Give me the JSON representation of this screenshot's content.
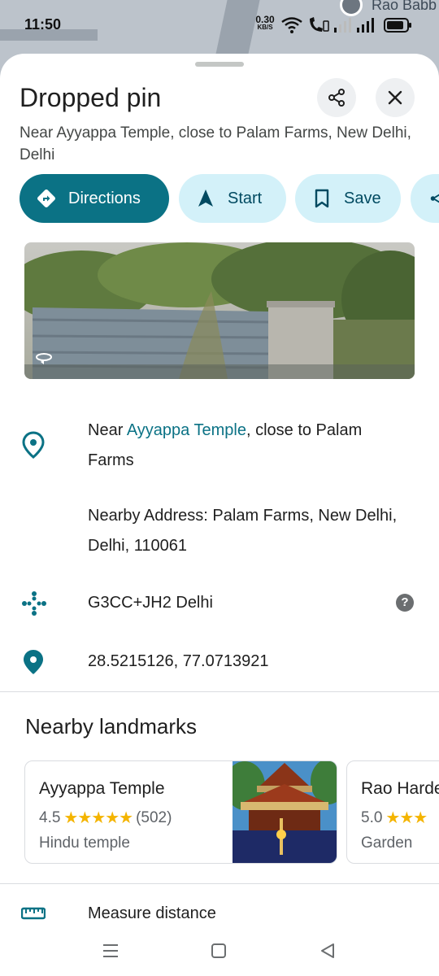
{
  "status_bar": {
    "time": "11:50",
    "net_speed": "0.30",
    "net_unit": "KB/S"
  },
  "map": {
    "label": "Rao Babb"
  },
  "place": {
    "title": "Dropped pin",
    "subtitle": "Near Ayyappa Temple, close to Palam Farms, New Delhi, Delhi"
  },
  "actions": [
    {
      "label": "Directions",
      "icon": "directions-icon"
    },
    {
      "label": "Start",
      "icon": "navigation-arrow-icon"
    },
    {
      "label": "Save",
      "icon": "bookmark-icon"
    },
    {
      "label": "",
      "icon": "share-icon"
    }
  ],
  "info": {
    "near_prefix": "Near ",
    "near_link": "Ayyappa Temple",
    "near_suffix": ", close to Palam",
    "near_line2": "Farms",
    "nearby_line1": "Nearby Address: Palam Farms, New Delhi,",
    "nearby_line2": "Delhi, 110061",
    "plus_code": "G3CC+JH2 Delhi",
    "help_glyph": "?",
    "coordinates": "28.5215126, 77.0713921"
  },
  "nearby": {
    "title": "Nearby landmarks",
    "cards": [
      {
        "name": "Ayyappa Temple",
        "rating": "4.5",
        "stars": "★★★★★",
        "reviews": "(502)",
        "type": "Hindu temple"
      },
      {
        "name": "Rao Harde",
        "rating": "5.0",
        "stars": "★★★",
        "reviews": "",
        "type": "Garden"
      }
    ]
  },
  "measure": {
    "label": "Measure distance"
  },
  "colors": {
    "accent": "#0b7285",
    "chip_bg": "#d3f1f9",
    "star": "#f4b400"
  }
}
